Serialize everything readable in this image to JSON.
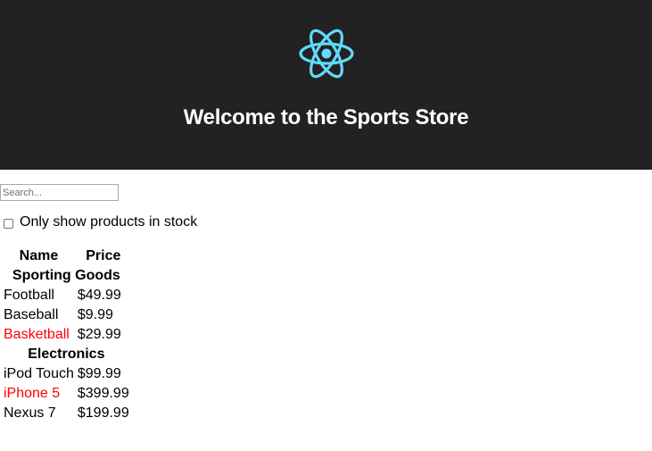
{
  "header": {
    "title": "Welcome to the Sports Store",
    "logo_icon": "react-atom-icon",
    "logo_color": "#61dafb",
    "background_color": "#222222"
  },
  "search": {
    "placeholder": "Search...",
    "value": ""
  },
  "stock_filter": {
    "label": "Only show products in stock",
    "checked": false
  },
  "table": {
    "headers": [
      "Name",
      "Price"
    ],
    "out_of_stock_color": "#ff0000",
    "categories": [
      {
        "name": "Sporting Goods",
        "products": [
          {
            "name": "Football",
            "price": "$49.99",
            "in_stock": true
          },
          {
            "name": "Baseball",
            "price": "$9.99",
            "in_stock": true
          },
          {
            "name": "Basketball",
            "price": "$29.99",
            "in_stock": false
          }
        ]
      },
      {
        "name": "Electronics",
        "products": [
          {
            "name": "iPod Touch",
            "price": "$99.99",
            "in_stock": true
          },
          {
            "name": "iPhone 5",
            "price": "$399.99",
            "in_stock": false
          },
          {
            "name": "Nexus 7",
            "price": "$199.99",
            "in_stock": true
          }
        ]
      }
    ]
  }
}
